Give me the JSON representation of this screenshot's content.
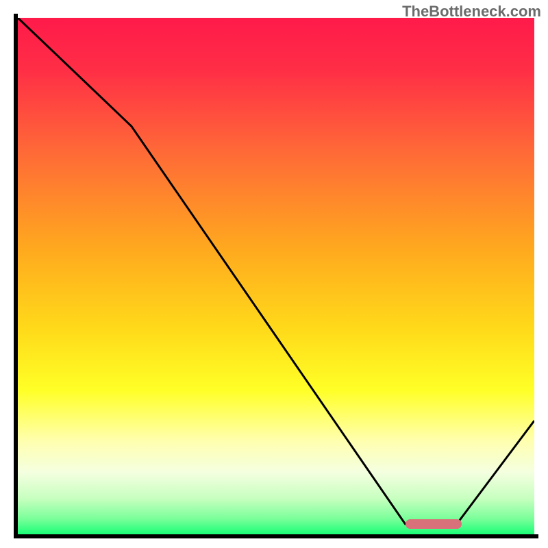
{
  "watermark": "TheBottleneck.com",
  "chart_data": {
    "type": "line",
    "title": "",
    "xlabel": "",
    "ylabel": "",
    "xlim": [
      0,
      100
    ],
    "ylim": [
      0,
      100
    ],
    "curve": [
      {
        "x": 0,
        "y": 100
      },
      {
        "x": 22,
        "y": 79
      },
      {
        "x": 75,
        "y": 2
      },
      {
        "x": 85,
        "y": 2
      },
      {
        "x": 100,
        "y": 22
      }
    ],
    "optimal_marker": {
      "x_start": 75,
      "x_end": 86,
      "y": 2
    },
    "gradient_stops": [
      {
        "offset": 0.0,
        "color": "#ff1a4a"
      },
      {
        "offset": 0.1,
        "color": "#ff2e46"
      },
      {
        "offset": 0.25,
        "color": "#ff6638"
      },
      {
        "offset": 0.45,
        "color": "#ffaa1e"
      },
      {
        "offset": 0.6,
        "color": "#ffd91a"
      },
      {
        "offset": 0.72,
        "color": "#ffff26"
      },
      {
        "offset": 0.82,
        "color": "#ffffb0"
      },
      {
        "offset": 0.88,
        "color": "#f4ffe0"
      },
      {
        "offset": 0.93,
        "color": "#c8ffc0"
      },
      {
        "offset": 0.97,
        "color": "#7aff9a"
      },
      {
        "offset": 1.0,
        "color": "#1aff77"
      }
    ]
  }
}
